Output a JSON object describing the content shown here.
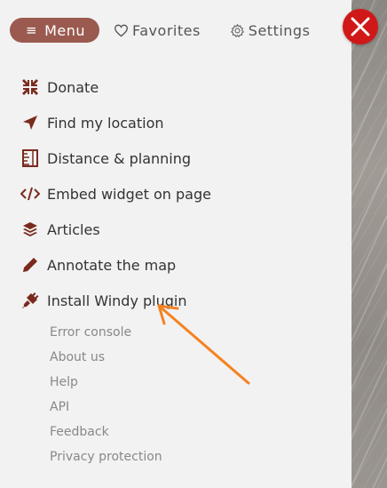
{
  "tabs": {
    "menu_label": "Menu",
    "favorites_label": "Favorites",
    "settings_label": "Settings"
  },
  "menu": {
    "items": [
      {
        "label": "Donate",
        "icon": "compress-arrows-icon"
      },
      {
        "label": "Find my location",
        "icon": "location-arrow-icon"
      },
      {
        "label": "Distance & planning",
        "icon": "ruler-icon"
      },
      {
        "label": "Embed widget on page",
        "icon": "code-icon"
      },
      {
        "label": "Articles",
        "icon": "layers-icon"
      },
      {
        "label": "Annotate the map",
        "icon": "pencil-icon"
      },
      {
        "label": "Install Windy plugin",
        "icon": "plug-icon"
      }
    ]
  },
  "links": {
    "items": [
      "Error console",
      "About us",
      "Help",
      "API",
      "Feedback",
      "Privacy protection"
    ]
  },
  "colors": {
    "accent": "#9a5a4f",
    "icon": "#7a2a1e",
    "close": "#d01818",
    "annotation_arrow": "#f58220"
  }
}
